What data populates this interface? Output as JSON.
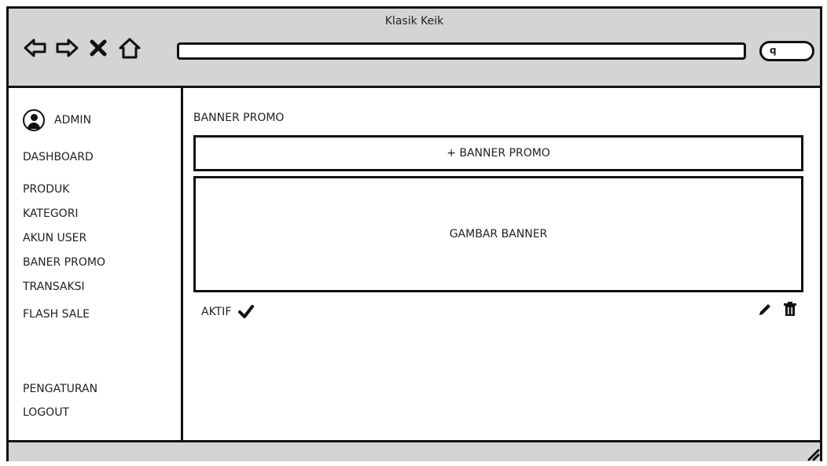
{
  "window": {
    "title": "Klasik Keik"
  },
  "browser": {
    "search_icon": "search-icon",
    "nav_icons": [
      "back-icon",
      "forward-icon",
      "close-icon",
      "home-icon"
    ]
  },
  "sidebar": {
    "user_label": "ADMIN",
    "items": [
      {
        "label": "DASHBOARD"
      },
      {
        "label": "PRODUK"
      },
      {
        "label": "KATEGORI"
      },
      {
        "label": "AKUN USER"
      },
      {
        "label": "BANER PROMO"
      },
      {
        "label": "TRANSAKSI"
      },
      {
        "label": "FLASH SALE"
      }
    ],
    "bottom_items": [
      {
        "label": "PENGATURAN"
      },
      {
        "label": "LOGOUT"
      }
    ]
  },
  "main": {
    "title": "BANNER PROMO",
    "add_button_label": "+ BANNER PROMO",
    "banner_placeholder": "GAMBAR BANNER",
    "status_label": "AKTIF"
  }
}
